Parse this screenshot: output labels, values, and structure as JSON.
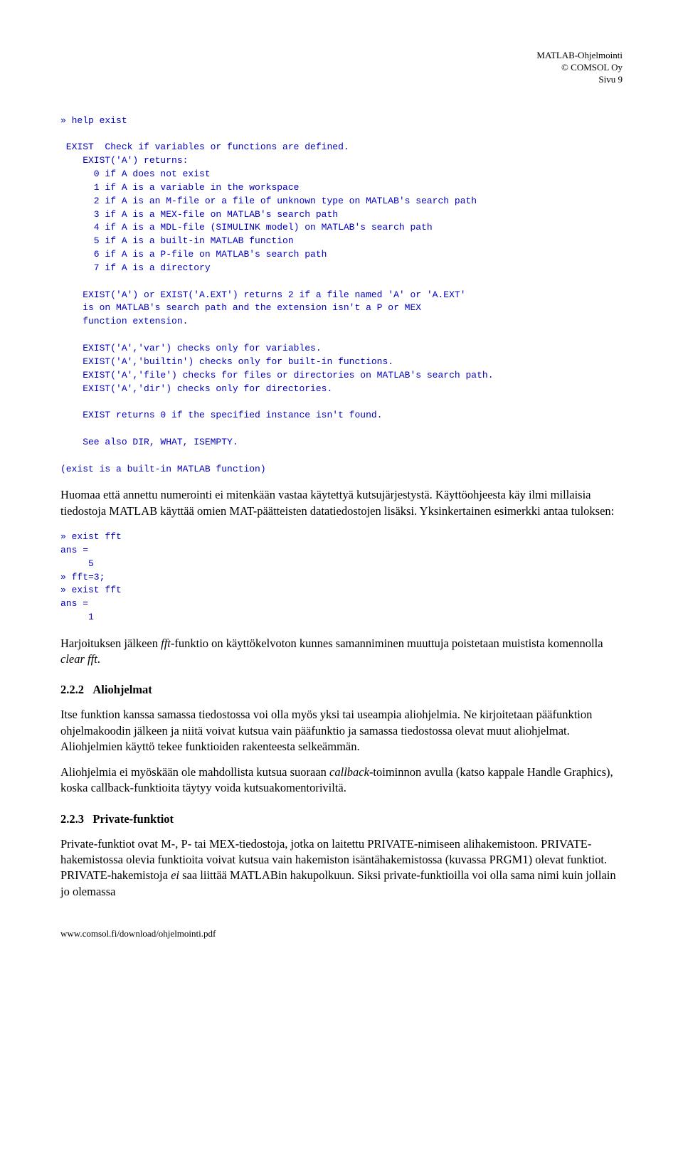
{
  "header": {
    "line1": "MATLAB-Ohjelmointi",
    "line2": "© COMSOL Oy",
    "line3": "Sivu 9"
  },
  "code1": "» help exist\n\n EXIST  Check if variables or functions are defined.\n    EXIST('A') returns:\n      0 if A does not exist\n      1 if A is a variable in the workspace\n      2 if A is an M-file or a file of unknown type on MATLAB's search path\n      3 if A is a MEX-file on MATLAB's search path\n      4 if A is a MDL-file (SIMULINK model) on MATLAB's search path\n      5 if A is a built-in MATLAB function\n      6 if A is a P-file on MATLAB's search path\n      7 if A is a directory\n\n    EXIST('A') or EXIST('A.EXT') returns 2 if a file named 'A' or 'A.EXT'\n    is on MATLAB's search path and the extension isn't a P or MEX\n    function extension.\n\n    EXIST('A','var') checks only for variables.\n    EXIST('A','builtin') checks only for built-in functions.\n    EXIST('A','file') checks for files or directories on MATLAB's search path.\n    EXIST('A','dir') checks only for directories.\n\n    EXIST returns 0 if the specified instance isn't found.\n\n    See also DIR, WHAT, ISEMPTY.\n\n(exist is a built-in MATLAB function)",
  "para1": "Huomaa että annettu numerointi ei mitenkään vastaa käytettyä kutsujärjestystä. Käyttöohjeesta käy ilmi millaisia tiedostoja MATLAB käyttää omien MAT-päätteisten datatiedostojen lisäksi. Yksinkertainen esimerkki antaa tuloksen:",
  "code2": "» exist fft\nans =\n     5\n» fft=3;\n» exist fft\nans =\n     1",
  "para2_a": "Harjoituksen jälkeen ",
  "para2_i1": "fft",
  "para2_b": "-funktio on käyttökelvoton kunnes samanniminen muuttuja poistetaan muistista komennolla ",
  "para2_i2": "clear fft",
  "para2_c": ".",
  "h3_1_num": "2.2.2",
  "h3_1_title": "Aliohjelmat",
  "para3": "Itse funktion kanssa samassa tiedostossa voi olla myös yksi tai useampia aliohjelmia. Ne kirjoitetaan pääfunktion ohjelmakoodin jälkeen ja niitä voivat kutsua vain pääfunktio ja samassa tiedostossa olevat muut aliohjelmat. Aliohjelmien käyttö tekee funktioiden rakenteesta selkeämmän.",
  "para4_a": "Aliohjelmia ei myöskään ole mahdollista kutsua suoraan ",
  "para4_i1": "callback",
  "para4_b": "-toiminnon avulla (katso kappale Handle Graphics), koska callback-funktioita täytyy voida kutsuakomentoriviltä.",
  "h3_2_num": "2.2.3",
  "h3_2_title": "Private-funktiot",
  "para5_a": "Private-funktiot ovat M-, P- tai MEX-tiedostoja, jotka on laitettu PRIVATE-nimiseen alihakemistoon. PRIVATE-hakemistossa olevia funktioita voivat kutsua vain hakemiston isäntähakemistossa (kuvassa PRGM1) olevat funktiot. PRIVATE-hakemistoja ",
  "para5_i1": "ei",
  "para5_b": " saa liittää MATLABin hakupolkuun. Siksi private-funktioilla voi olla sama nimi kuin jollain jo olemassa",
  "footer": "www.comsol.fi/download/ohjelmointi.pdf"
}
